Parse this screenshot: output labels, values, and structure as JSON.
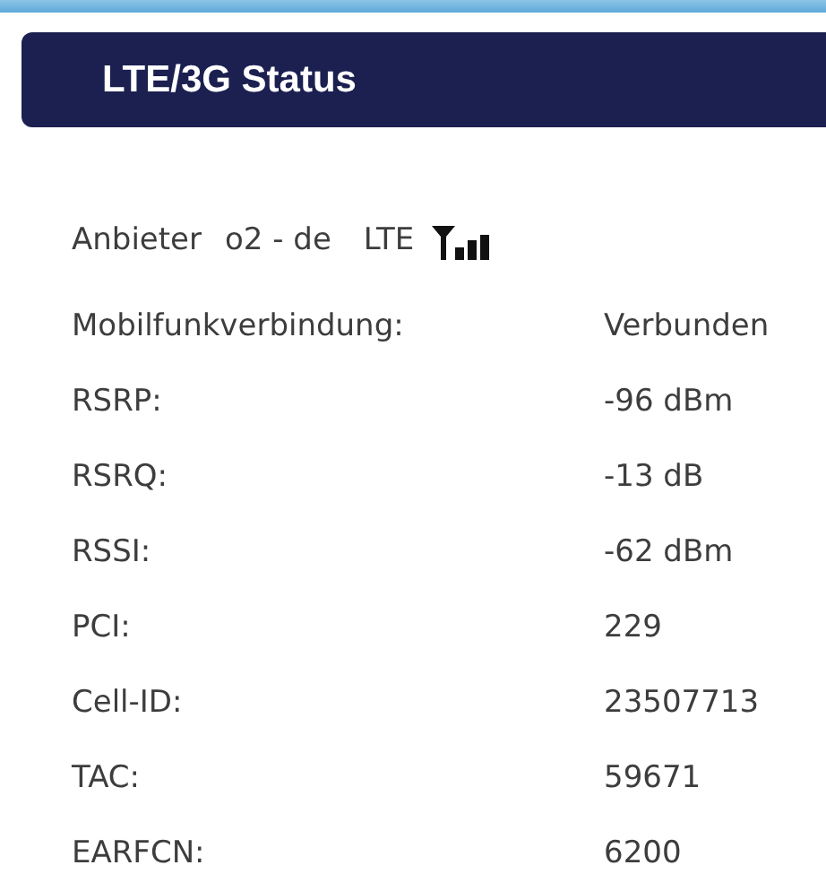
{
  "header": {
    "title": "LTE/3G Status"
  },
  "provider": {
    "label": "Anbieter",
    "name": "o2 - de",
    "technology": "LTE"
  },
  "rows": [
    {
      "label": "Mobilfunkverbindung:",
      "value": "Verbunden"
    },
    {
      "label": "RSRP:",
      "value": "-96 dBm"
    },
    {
      "label": "RSRQ:",
      "value": "-13 dB"
    },
    {
      "label": "RSSI:",
      "value": "-62 dBm"
    },
    {
      "label": "PCI:",
      "value": "229"
    },
    {
      "label": "Cell-ID:",
      "value": "23507713"
    },
    {
      "label": "TAC:",
      "value": "59671"
    },
    {
      "label": "EARFCN:",
      "value": "6200"
    }
  ]
}
